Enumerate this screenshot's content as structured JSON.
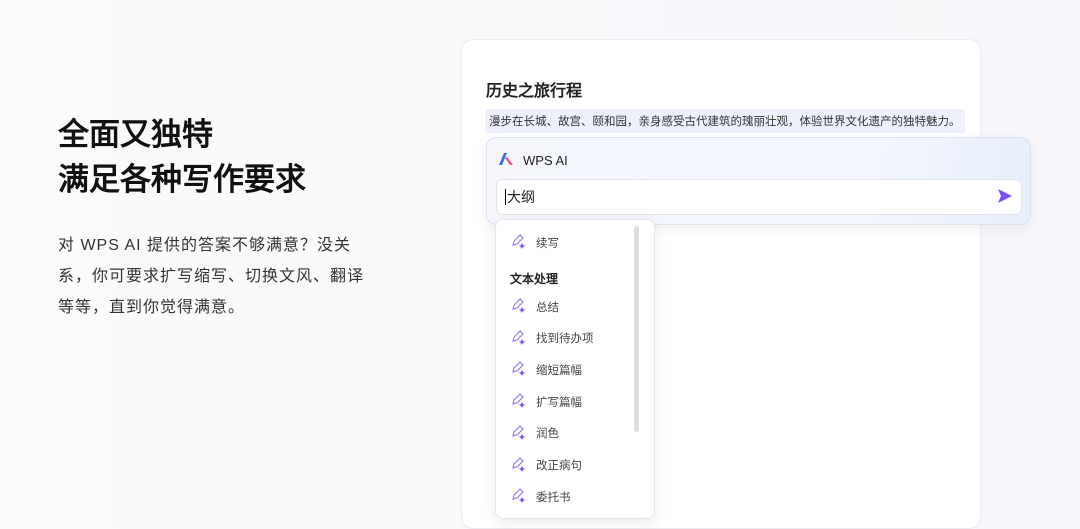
{
  "hero": {
    "title_line1": "全面又独特",
    "title_line2": "满足各种写作要求",
    "description": "对 WPS AI 提供的答案不够满意？没关系，你可要求扩写缩写、切换文风、翻译等等，直到你觉得满意。"
  },
  "document": {
    "title": "历史之旅行程",
    "highlighted_text": "漫步在长城、故宫、颐和园，亲身感受古代建筑的瑰丽壮观，体验世界文化遗产的独特魅力。"
  },
  "ai_panel": {
    "name": "WPS AI",
    "input_value": "大纲",
    "accent": "#7b4dff"
  },
  "menu": {
    "top_item": "续写",
    "section": "文本处理",
    "items": [
      "总结",
      "找到待办项",
      "缩短篇幅",
      "扩写篇幅",
      "润色",
      "改正病句",
      "委托书"
    ]
  }
}
